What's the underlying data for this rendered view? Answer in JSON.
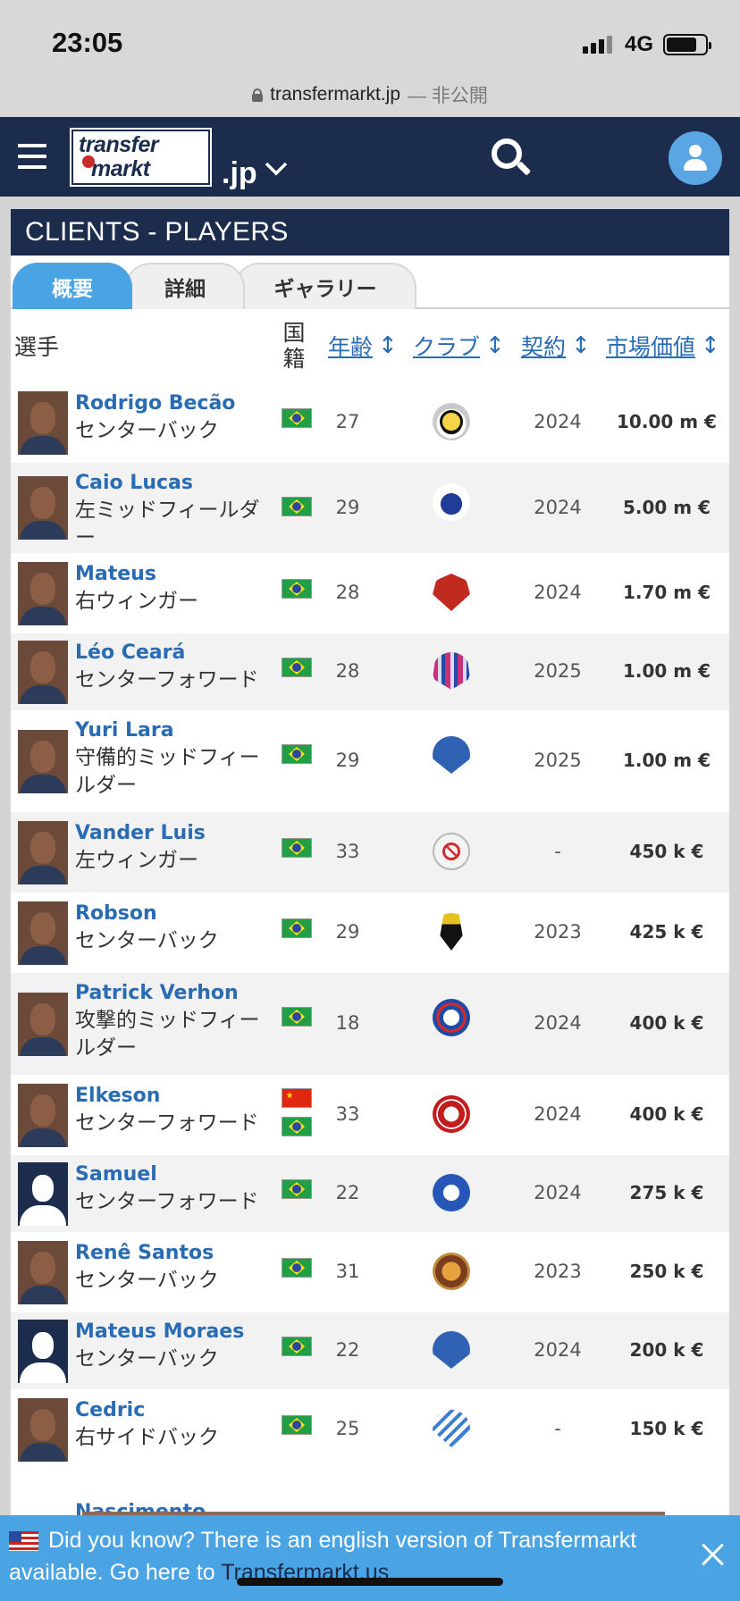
{
  "status_bar": {
    "time": "23:05",
    "network": "4G"
  },
  "url_bar": {
    "domain": "transfermarkt.jp",
    "suffix": "— 非公開"
  },
  "site": {
    "logo_line1": "transfer",
    "logo_line2": "markt",
    "tld": ".jp"
  },
  "section_title": "CLIENTS - PLAYERS",
  "tabs": [
    {
      "label": "概要",
      "active": true
    },
    {
      "label": "詳細",
      "active": false
    },
    {
      "label": "ギャラリー",
      "active": false
    }
  ],
  "table_headers": {
    "player": "選手",
    "nationality_1": "国",
    "nationality_2": "籍",
    "age": "年齢",
    "club": "クラブ",
    "contract": "契約",
    "market_value": "市場価値",
    "sort_arrow": "↕"
  },
  "players": [
    {
      "name": "Rodrigo Becão",
      "position": "センターバック",
      "nationality": [
        "Brazil"
      ],
      "age": "27",
      "club": "udinese",
      "contract": "2024",
      "market_value": "10.00 m €"
    },
    {
      "name": "Caio Lucas",
      "position": "左ミッドフィールダー",
      "nationality": [
        "Brazil"
      ],
      "age": "29",
      "club": "cruzeiro",
      "contract": "2024",
      "market_value": "5.00 m €"
    },
    {
      "name": "Mateus",
      "position": "右ウィンガー",
      "nationality": [
        "Brazil"
      ],
      "age": "28",
      "club": "nagoya",
      "contract": "2024",
      "market_value": "1.70 m €"
    },
    {
      "name": "Léo Ceará",
      "position": "センターフォワード",
      "nationality": [
        "Brazil"
      ],
      "age": "28",
      "club": "cerezo",
      "contract": "2025",
      "market_value": "1.00 m €"
    },
    {
      "name": "Yuri Lara",
      "position": "守備的ミッドフィールダー",
      "nationality": [
        "Brazil"
      ],
      "age": "29",
      "club": "yokohama",
      "contract": "2025",
      "market_value": "1.00 m €"
    },
    {
      "name": "Vander Luis",
      "position": "左ウィンガー",
      "nationality": [
        "Brazil"
      ],
      "age": "33",
      "club": "none",
      "contract": "-",
      "market_value": "450 k €"
    },
    {
      "name": "Robson",
      "position": "センターバック",
      "nationality": [
        "Brazil"
      ],
      "age": "29",
      "club": "amazonas",
      "contract": "2023",
      "market_value": "425 k €"
    },
    {
      "name": "Patrick Verhon",
      "position": "攻撃的ミッドフィールダー",
      "nationality": [
        "Brazil"
      ],
      "age": "18",
      "club": "bahia",
      "contract": "2024",
      "market_value": "400 k €"
    },
    {
      "name": "Elkeson",
      "position": "センターフォワード",
      "nationality": [
        "China",
        "Brazil"
      ],
      "age": "33",
      "club": "toluca",
      "contract": "2024",
      "market_value": "400 k €"
    },
    {
      "name": "Samuel",
      "position": "センターフォワード",
      "nationality": [
        "Brazil"
      ],
      "age": "22",
      "club": "zweigen",
      "contract": "2024",
      "market_value": "275 k €"
    },
    {
      "name": "Renê Santos",
      "position": "センターバック",
      "nationality": [
        "Brazil"
      ],
      "age": "31",
      "club": "lion",
      "contract": "2023",
      "market_value": "250 k €"
    },
    {
      "name": "Mateus Moraes",
      "position": "センターバック",
      "nationality": [
        "Brazil"
      ],
      "age": "22",
      "club": "yokohama",
      "contract": "2024",
      "market_value": "200 k €"
    },
    {
      "name": "Cedric",
      "position": "右サイドバック",
      "nationality": [
        "Brazil"
      ],
      "age": "25",
      "club": "csa",
      "contract": "-",
      "market_value": "150 k €"
    }
  ],
  "peek_row_name": "Nascimento",
  "banner": {
    "text": "Did you know? There is an english version of Transfermarkt available. Go here to ",
    "link": "Transfermarkt.us"
  },
  "colors": {
    "navy": "#1b2c4d",
    "accent_blue": "#4aa3e2",
    "link_blue": "#2a6cb3"
  }
}
